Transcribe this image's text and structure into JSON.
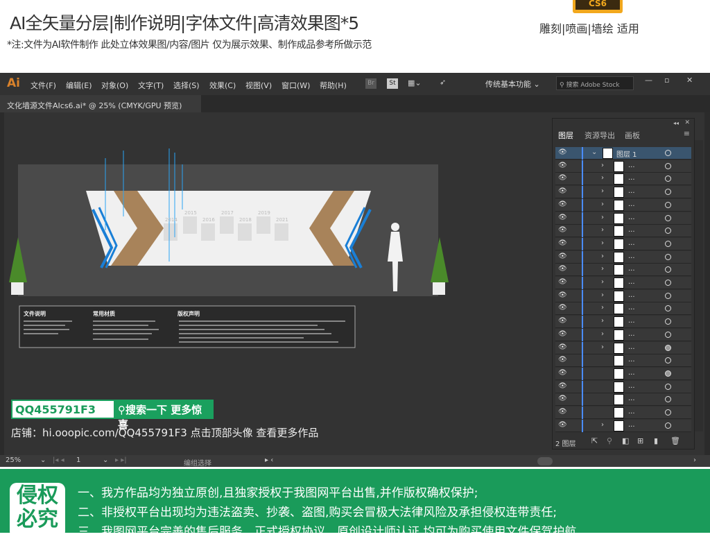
{
  "header": {
    "title": "AI全矢量分层|制作说明|字体文件|高清效果图*5",
    "subtitle": "*注:文件为AI软件制作 此处立体效果图/内容/图片 仅为展示效果、制作成品参考所做示范",
    "version_badge": "CS6",
    "usage": "雕刻|喷画|墙绘 适用"
  },
  "app": {
    "logo": "Ai",
    "menu": [
      "文件(F)",
      "编辑(E)",
      "对象(O)",
      "文字(T)",
      "选择(S)",
      "效果(C)",
      "视图(V)",
      "窗口(W)",
      "帮助(H)"
    ],
    "bridge": "Br",
    "stock": "St",
    "workspace": "传统基本功能",
    "search_placeholder": "搜索 Adobe Stock",
    "doc_tab": "文化墙源文件AIcs6.ai* @ 25% (CMYK/GPU 预览)",
    "doc_close": "×"
  },
  "artwork": {
    "years": [
      "2014",
      "2015",
      "2016",
      "2017",
      "2018",
      "2019",
      "2021"
    ]
  },
  "info": {
    "sections": [
      "文件说明",
      "常用材质",
      "版权声明"
    ]
  },
  "layers_panel": {
    "tabs": [
      "图层",
      "资源导出",
      "画板"
    ],
    "top_layer": "图层 1",
    "sublayer_name": "...",
    "rows": [
      {
        "chev": true,
        "fill": false
      },
      {
        "chev": true,
        "fill": false
      },
      {
        "chev": true,
        "fill": false
      },
      {
        "chev": true,
        "fill": false
      },
      {
        "chev": true,
        "fill": false
      },
      {
        "chev": true,
        "fill": false
      },
      {
        "chev": true,
        "fill": false
      },
      {
        "chev": true,
        "fill": false
      },
      {
        "chev": true,
        "fill": false
      },
      {
        "chev": true,
        "fill": false
      },
      {
        "chev": true,
        "fill": false
      },
      {
        "chev": true,
        "fill": false
      },
      {
        "chev": true,
        "fill": false
      },
      {
        "chev": true,
        "fill": false
      },
      {
        "chev": true,
        "fill": true
      },
      {
        "chev": false,
        "fill": false
      },
      {
        "chev": false,
        "fill": true
      },
      {
        "chev": false,
        "fill": false
      },
      {
        "chev": false,
        "fill": false
      },
      {
        "chev": false,
        "fill": false
      },
      {
        "chev": true,
        "fill": false
      }
    ],
    "footer_count": "2 图层"
  },
  "status": {
    "zoom": "25%",
    "artboard": "1",
    "tool": "编组选择"
  },
  "promo": {
    "qq": "QQ455791F3",
    "search_btn": "搜索一下 更多惊喜",
    "shop": "店铺：hi.ooopic.com/QQ455791F3  点击顶部头像 查看更多作品"
  },
  "footer": {
    "badge": "侵权必究",
    "lines": [
      "一、我方作品均为独立原创,且独家授权于我图网平台出售,并作版权确权保护;",
      "二、非授权平台出现均为违法盗卖、抄袭、盗图,购买会冒极大法律风险及承担侵权连带责任;",
      "三、我图网平台完善的售后服务、正式授权协议、原创设计师认证,均可为购买使用文件保驾护航。"
    ]
  },
  "colors": {
    "accent_green": "#1a9b5a",
    "ai_orange": "#d9822b",
    "layer_blue": "#4a8cff"
  }
}
